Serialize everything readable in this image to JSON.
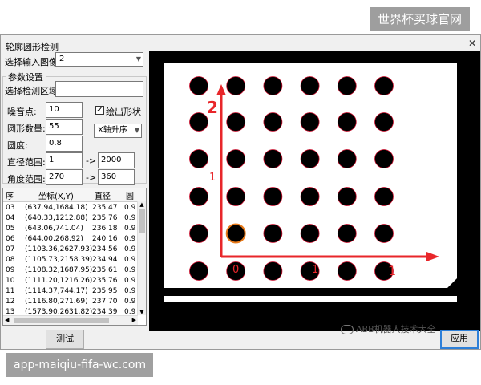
{
  "watermark_top": "世界杯买球官网",
  "watermark_bottom": "app-maiqiu-fifa-wc.com",
  "window": {
    "title": "轮廓圆形检测"
  },
  "input_image": {
    "label": "选择输入图像:",
    "value": "2"
  },
  "params": {
    "group_title": "参数设置",
    "region_label": "选择检测区域:",
    "region_value": "",
    "noise_label": "噪音点:",
    "noise_value": "10",
    "count_label": "圆形数量:",
    "count_value": "55",
    "roundness_label": "圆度:",
    "roundness_value": "0.8",
    "diameter_label": "直径范围:",
    "diameter_min": "1",
    "diameter_max": "2000",
    "angle_label": "角度范围:",
    "angle_min": "270",
    "angle_max": "360",
    "range_sep": "->",
    "draw_shape_label": "绘出形状",
    "draw_shape_checked": true,
    "sort_value": "X轴升序"
  },
  "table": {
    "headers": [
      "序",
      "坐标(X,Y)",
      "直径",
      "圆"
    ],
    "rows": [
      [
        "03",
        "(637.94,1684.18)",
        "235.47",
        "0.9"
      ],
      [
        "04",
        "(640.33,1212.88)",
        "235.76",
        "0.9"
      ],
      [
        "05",
        "(643.06,741.04)",
        "236.18",
        "0.9"
      ],
      [
        "06",
        "(644.00,268.92)",
        "240.16",
        "0.9"
      ],
      [
        "07",
        "(1103.36,2627.93)",
        "234.56",
        "0.9"
      ],
      [
        "08",
        "(1105.73,2158.39)",
        "234.94",
        "0.9"
      ],
      [
        "09",
        "(1108.32,1687.95)",
        "235.61",
        "0.9"
      ],
      [
        "10",
        "(1111.20,1216.26)",
        "235.76",
        "0.9"
      ],
      [
        "11",
        "(1114.37,744.17)",
        "235.95",
        "0.9"
      ],
      [
        "12",
        "(1116.80,271.69)",
        "237.70",
        "0.9"
      ],
      [
        "13",
        "(1573.90,2631.82)",
        "234.39",
        "0.9"
      ]
    ]
  },
  "buttons": {
    "test": "测试",
    "apply": "应用"
  },
  "overlay": {
    "label_2": "2",
    "label_1_vertical": "1",
    "label_1_horizontal": "1",
    "label_0": "0",
    "wechat_text": "ABB机器人技术大全"
  },
  "colors": {
    "arrow": "#e8262a",
    "circle_edge": "#c8102e",
    "highlight": "#e87a1a"
  }
}
